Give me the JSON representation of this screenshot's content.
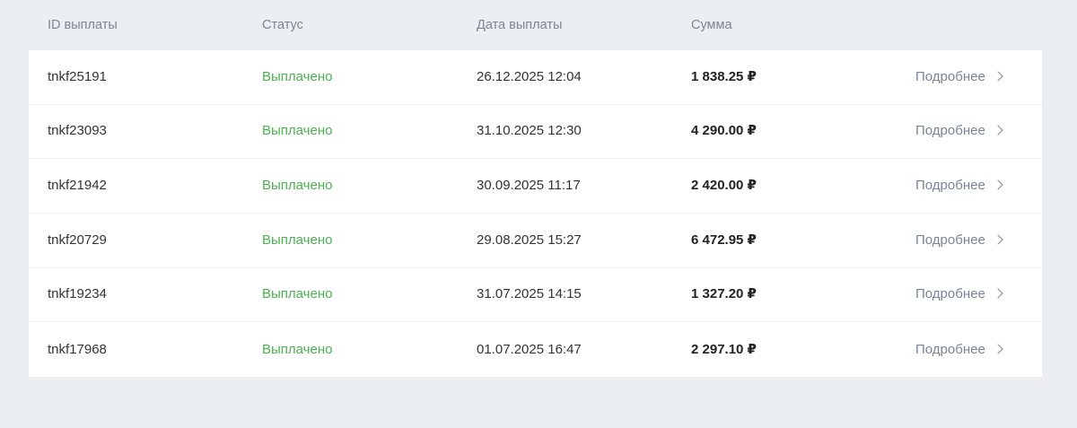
{
  "header": {
    "id": "ID выплаты",
    "status": "Статус",
    "date": "Дата выплаты",
    "sum": "Сумма"
  },
  "colors": {
    "page_bg": "#eceff2",
    "status_paid": "#4caf50",
    "muted": "#7b8494"
  },
  "rows": [
    {
      "id": "tnkf25191",
      "status": "Выплачено",
      "date": "26.12.2025 12:04",
      "sum": "1 838.25 ₽",
      "more": "Подробнее"
    },
    {
      "id": "tnkf23093",
      "status": "Выплачено",
      "date": "31.10.2025 12:30",
      "sum": "4 290.00 ₽",
      "more": "Подробнее"
    },
    {
      "id": "tnkf21942",
      "status": "Выплачено",
      "date": "30.09.2025 11:17",
      "sum": "2 420.00 ₽",
      "more": "Подробнее"
    },
    {
      "id": "tnkf20729",
      "status": "Выплачено",
      "date": "29.08.2025 15:27",
      "sum": "6 472.95 ₽",
      "more": "Подробнее"
    },
    {
      "id": "tnkf19234",
      "status": "Выплачено",
      "date": "31.07.2025 14:15",
      "sum": "1 327.20 ₽",
      "more": "Подробнее"
    },
    {
      "id": "tnkf17968",
      "status": "Выплачено",
      "date": "01.07.2025 16:47",
      "sum": "2 297.10 ₽",
      "more": "Подробнее"
    }
  ]
}
